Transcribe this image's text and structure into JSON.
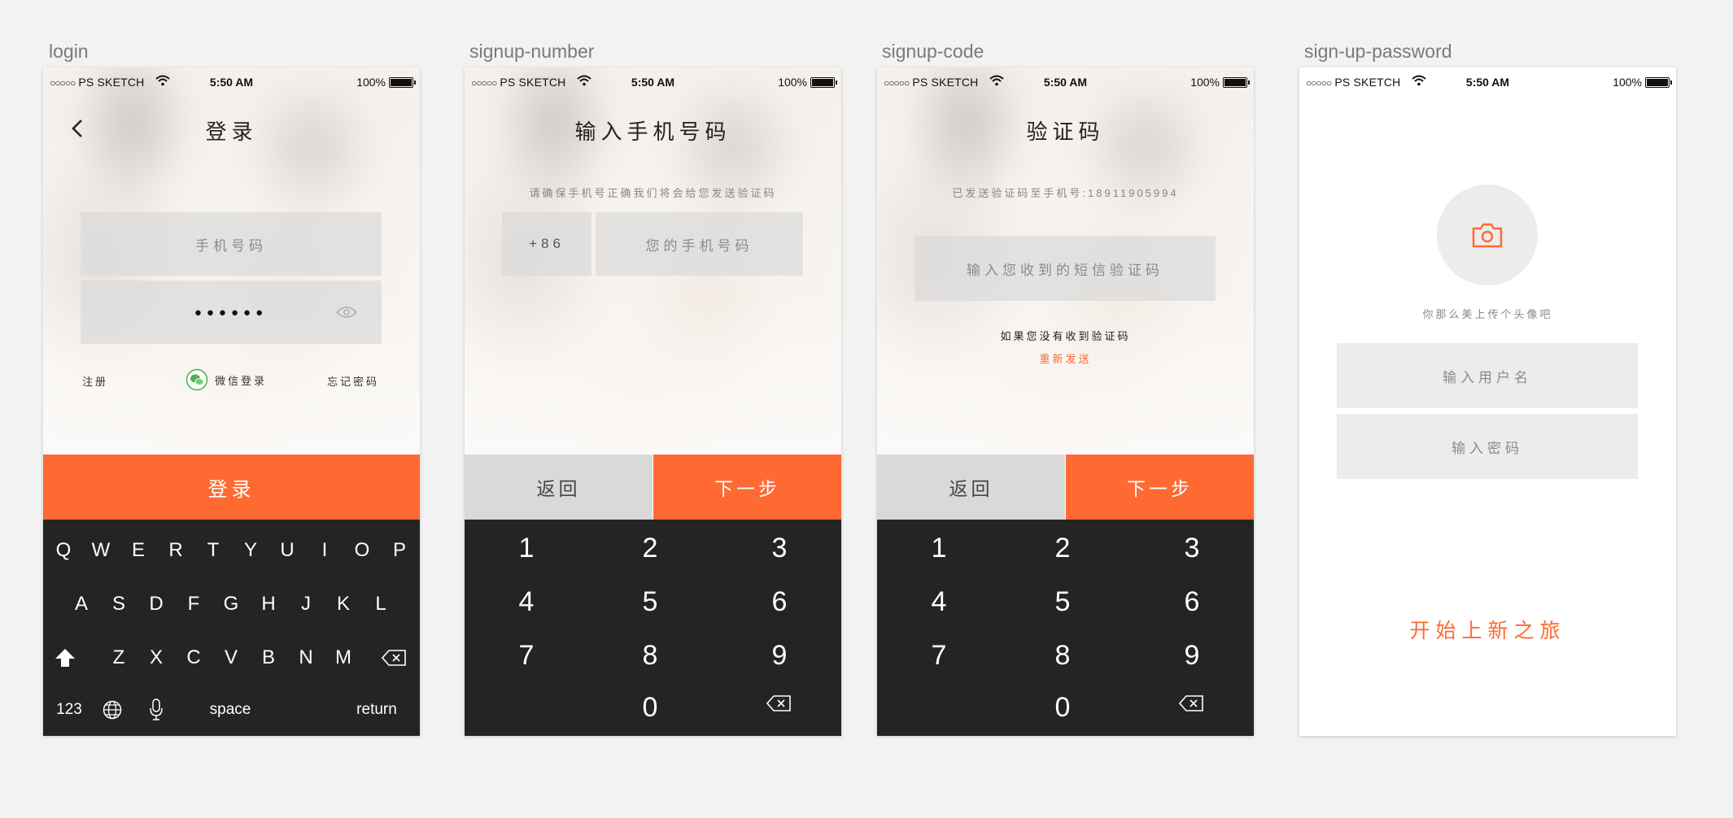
{
  "artboards": [
    {
      "label": "login"
    },
    {
      "label": "signup-number"
    },
    {
      "label": "signup-code"
    },
    {
      "label": "sign-up-password"
    }
  ],
  "status_bar": {
    "carrier": "PS SKETCH",
    "dots": "○○○○○",
    "time": "5:50 AM",
    "battery": "100%"
  },
  "login": {
    "title": "登录",
    "phone_placeholder": "手机号码",
    "password_mask": "●●●●●●",
    "register": "注册",
    "wechat_login": "微信登录",
    "forgot_password": "忘记密码",
    "login_button": "登录",
    "keyboard": {
      "row1": [
        "Q",
        "W",
        "E",
        "R",
        "T",
        "Y",
        "U",
        "I",
        "O",
        "P"
      ],
      "row2": [
        "A",
        "S",
        "D",
        "F",
        "G",
        "H",
        "J",
        "K",
        "L"
      ],
      "row3": [
        "Z",
        "X",
        "C",
        "V",
        "B",
        "N",
        "M"
      ],
      "numbers_key": "123",
      "space_key": "space",
      "return_key": "return"
    }
  },
  "signup_number": {
    "title": "输入手机号码",
    "hint": "请确保手机号正确我们将会给您发送验证码",
    "country_code": "+86",
    "phone_placeholder": "您的手机号码",
    "back_button": "返回",
    "next_button": "下一步"
  },
  "signup_code": {
    "title": "验证码",
    "hint": "已发送验证码至手机号:18911905994",
    "code_placeholder": "输入您收到的短信验证码",
    "not_received": "如果您没有收到验证码",
    "resend": "重新发送",
    "back_button": "返回",
    "next_button": "下一步"
  },
  "numpad": {
    "keys": [
      "1",
      "2",
      "3",
      "4",
      "5",
      "6",
      "7",
      "8",
      "9",
      "0"
    ]
  },
  "signup_password": {
    "avatar_hint": "你那么美上传个头像吧",
    "username_placeholder": "输入用户名",
    "password_placeholder": "输入密码",
    "start_button": "开始上新之旅"
  },
  "colors": {
    "accent": "#ff6a32",
    "keyboard_bg": "#242424",
    "field_bg": "#e6e6e6",
    "canvas_bg": "#f2f2f2"
  }
}
